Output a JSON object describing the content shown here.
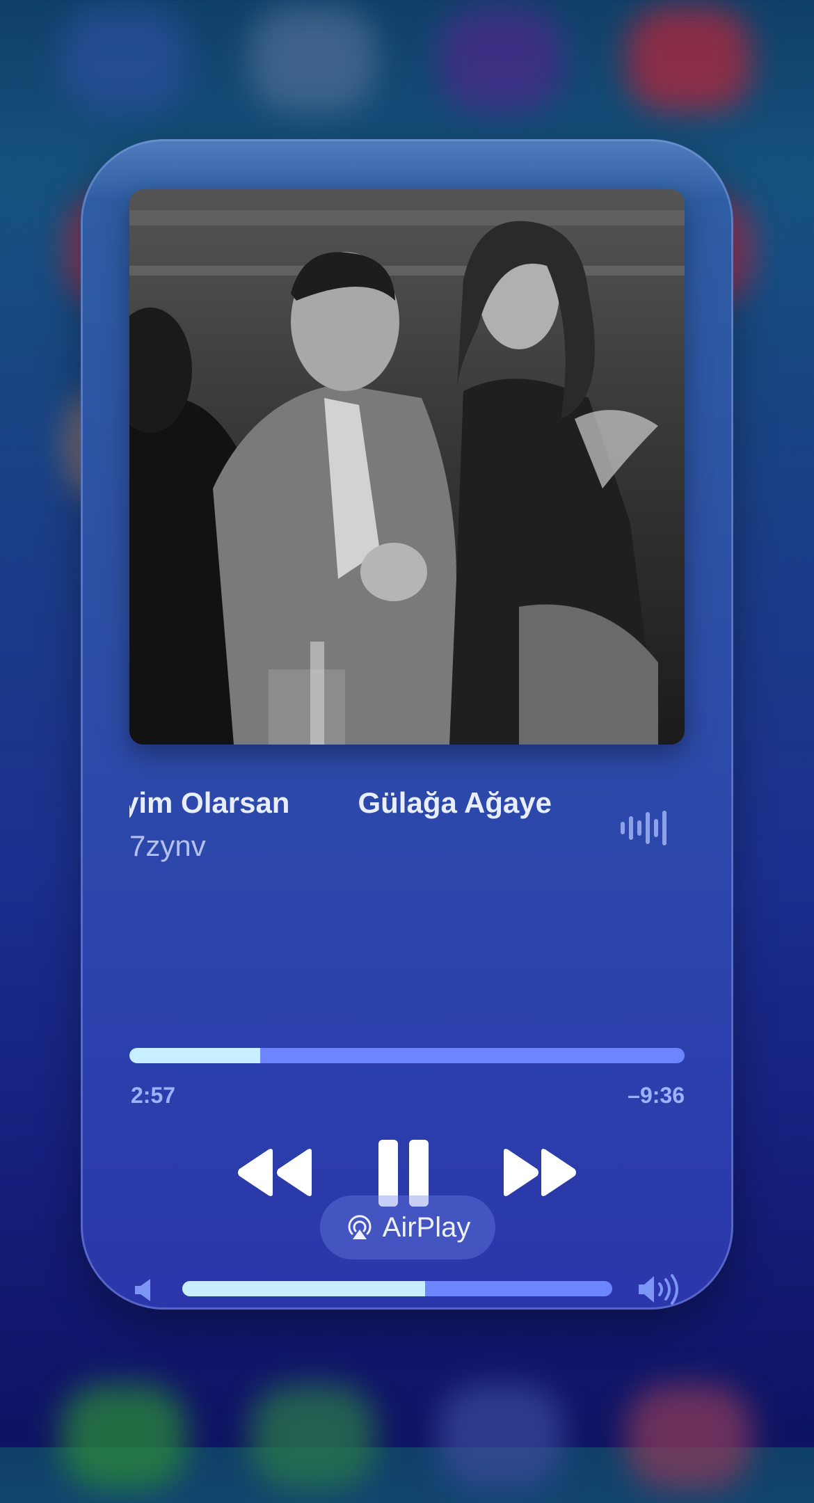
{
  "now_playing": {
    "title_marquee": "yim Olarsan",
    "artist_marquee": "Gülağa Ağaye",
    "subtitle": "7zynv",
    "elapsed": "2:57",
    "remaining": "–9:36",
    "progress_fraction": 0.235,
    "volume_fraction": 0.565
  },
  "airplay": {
    "label": "AirPlay"
  },
  "icons": {
    "waveform": "waveform-icon",
    "rewind": "rewind-icon",
    "pause": "pause-icon",
    "forward": "fast-forward-icon",
    "volume_low": "speaker-low-icon",
    "volume_high": "speaker-high-icon",
    "airplay": "airplay-icon"
  },
  "colors": {
    "progress_fill": "#c8efff",
    "progress_track": "#6d86ff",
    "time_text": "#9db3ff"
  }
}
